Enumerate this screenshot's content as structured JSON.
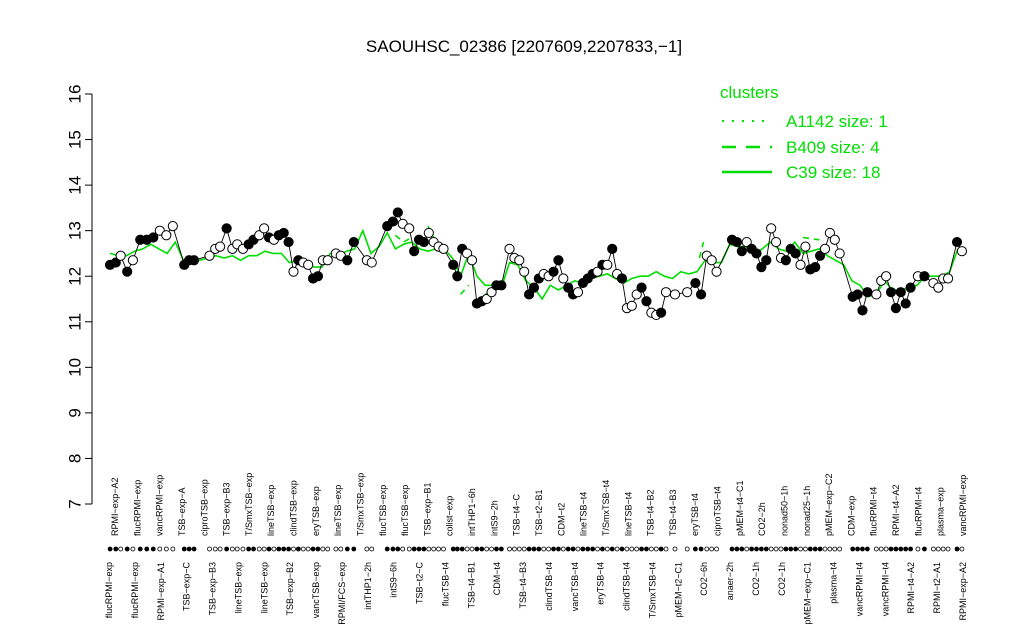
{
  "chart_data": {
    "type": "line",
    "title": "SAOUHSC_02386 [2207609,2207833,−1]",
    "xlabel": "",
    "ylabel": "",
    "ylim": [
      7,
      16
    ],
    "yticks": [
      7,
      8,
      9,
      10,
      11,
      12,
      13,
      14,
      15,
      16
    ],
    "grid": false,
    "legend": {
      "position": "top-right",
      "title": "clusters",
      "entries": [
        {
          "label": "A1142 size: 1",
          "style": "dotted"
        },
        {
          "label": "B409 size: 4",
          "style": "dashed"
        },
        {
          "label": "C39 size: 18",
          "style": "solid"
        }
      ]
    },
    "colors": {
      "line": "#00dd00",
      "points": "#000000",
      "text": "#000000"
    },
    "top_labels": [
      "RPMI−exp−A2",
      "flucRPMI−exp",
      "vancRPMI−exp",
      "TSB−exp−A",
      "ciproTSB−exp",
      "TSB−exp−B3",
      "T/SmxTSB−exp",
      "lineTSB−exp",
      "clindTSB−exp",
      "eryTSB−exp",
      "lineTSB−exp",
      "T/SmxTSB−exp",
      "flucTSB−exp",
      "flucTSB−exp",
      "TSB−exp−B1",
      "colist−exp",
      "intTHP1−6h",
      "intS9−2h",
      "TSB−t4−C",
      "TSB−t2−B1",
      "CDM−t2",
      "lineTSB−t4",
      "T/SmxTSB−t4",
      "lineTSB−t4",
      "TSB−t4−B2",
      "TSB−t4−B3",
      "eryTSB−t4",
      "ciproTSB−t4",
      "pMEM−t4−C1",
      "CO2−2h",
      "nonad50−1h",
      "nonad25−1h",
      "pMEM−exp−C2",
      "CDM−exp",
      "flucRPMI−t4",
      "RPMI−t4−A2",
      "flucRPMI−t4",
      "plasma−exp",
      "vancRPMI−exp"
    ],
    "bottom_labels": [
      "flucRPMI−exp",
      "flucRPMI−exp",
      "RPMI−exp−A1",
      "TSB−exp−C",
      "TSB−exp−B3",
      "lineTSB−exp",
      "lineTSB−exp",
      "TSB−exp−B2",
      "vancTSB−exp",
      "RPMI/FCS−exp",
      "intTHP1−2h",
      "intS9−6h",
      "TSB−t2−C",
      "flucTSB−t4",
      "TSB−t4−B1",
      "CDM−t4",
      "TSB−t4−B3",
      "clindTSB−t4",
      "vancTSB−t4",
      "eryTSB−t4",
      "clindTSB−t4",
      "T/SmxTSB−t4",
      "pMEM−t2−C1",
      "CO2−6h",
      "anaer−2h",
      "CO2−1h",
      "CO2−1h",
      "pMEM−exp−C1",
      "plasma−t4",
      "vancRPMI−t4",
      "vancRPMI−t4",
      "RPMI−t4−A2",
      "RPMI−t2−A1",
      "RPMI−exp−A2"
    ],
    "points": [
      [
        0.5,
        12.25,
        1
      ],
      [
        1.2,
        12.3,
        1
      ],
      [
        1.8,
        12.45,
        0
      ],
      [
        2.6,
        12.1,
        1
      ],
      [
        3.3,
        12.35,
        0
      ],
      [
        4.2,
        12.8,
        1
      ],
      [
        5,
        12.8,
        1
      ],
      [
        5.8,
        12.85,
        1
      ],
      [
        6.6,
        13,
        0
      ],
      [
        7.4,
        12.9,
        0
      ],
      [
        8.2,
        13.1,
        0
      ],
      [
        9.6,
        12.25,
        1
      ],
      [
        10.2,
        12.35,
        1
      ],
      [
        10.8,
        12.35,
        1
      ],
      [
        12.7,
        12.45,
        0
      ],
      [
        13.4,
        12.6,
        0
      ],
      [
        14,
        12.65,
        0
      ],
      [
        14.8,
        13.05,
        1
      ],
      [
        15.5,
        12.6,
        0
      ],
      [
        16.1,
        12.7,
        0
      ],
      [
        16.8,
        12.6,
        0
      ],
      [
        17.5,
        12.7,
        1
      ],
      [
        18.1,
        12.8,
        1
      ],
      [
        18.8,
        12.9,
        0
      ],
      [
        19.4,
        13.05,
        0
      ],
      [
        20,
        12.85,
        1
      ],
      [
        20.6,
        12.8,
        0
      ],
      [
        21.2,
        12.9,
        1
      ],
      [
        21.8,
        12.95,
        1
      ],
      [
        22.4,
        12.75,
        1
      ],
      [
        23,
        12.1,
        0
      ],
      [
        23.6,
        12.35,
        1
      ],
      [
        24.2,
        12.3,
        0
      ],
      [
        24.8,
        12.25,
        0
      ],
      [
        25.4,
        11.95,
        1
      ],
      [
        26,
        12.0,
        1
      ],
      [
        26.6,
        12.35,
        0
      ],
      [
        27.2,
        12.35,
        0
      ],
      [
        28.2,
        12.5,
        0
      ],
      [
        28.8,
        12.45,
        0
      ],
      [
        29.6,
        12.35,
        1
      ],
      [
        30.4,
        12.75,
        1
      ],
      [
        32,
        12.35,
        0
      ],
      [
        32.6,
        12.3,
        0
      ],
      [
        34.5,
        13.1,
        1
      ],
      [
        35.2,
        13.2,
        1
      ],
      [
        35.8,
        13.4,
        1
      ],
      [
        36.4,
        13.15,
        0
      ],
      [
        37.2,
        13.05,
        0
      ],
      [
        37.8,
        12.55,
        1
      ],
      [
        38.4,
        12.8,
        1
      ],
      [
        39,
        12.75,
        1
      ],
      [
        39.6,
        12.95,
        0
      ],
      [
        40.2,
        12.75,
        0
      ],
      [
        40.8,
        12.65,
        0
      ],
      [
        41.4,
        12.6,
        0
      ],
      [
        42.6,
        12.25,
        1
      ],
      [
        43.1,
        12.0,
        1
      ],
      [
        43.7,
        12.6,
        1
      ],
      [
        44.3,
        12.5,
        0
      ],
      [
        44.9,
        12.35,
        0
      ],
      [
        45.5,
        11.4,
        1
      ],
      [
        46.1,
        11.45,
        1
      ],
      [
        46.7,
        11.5,
        0
      ],
      [
        47.3,
        11.65,
        0
      ],
      [
        47.9,
        11.8,
        1
      ],
      [
        48.5,
        11.8,
        1
      ],
      [
        49.5,
        12.6,
        0
      ],
      [
        50.1,
        12.4,
        0
      ],
      [
        50.7,
        12.35,
        0
      ],
      [
        51.3,
        12.1,
        0
      ],
      [
        51.9,
        11.6,
        1
      ],
      [
        52.5,
        11.75,
        1
      ],
      [
        53.1,
        11.95,
        1
      ],
      [
        53.7,
        12.05,
        0
      ],
      [
        54.3,
        12.0,
        0
      ],
      [
        54.9,
        12.1,
        1
      ],
      [
        55.5,
        12.35,
        1
      ],
      [
        56.1,
        11.95,
        0
      ],
      [
        56.7,
        11.75,
        1
      ],
      [
        57.3,
        11.6,
        1
      ],
      [
        57.9,
        11.65,
        0
      ],
      [
        58.5,
        11.85,
        1
      ],
      [
        59.1,
        11.95,
        1
      ],
      [
        59.7,
        12.05,
        1
      ],
      [
        60.3,
        12.1,
        0
      ],
      [
        60.9,
        12.25,
        1
      ],
      [
        61.5,
        12.25,
        0
      ],
      [
        62.1,
        12.6,
        1
      ],
      [
        62.7,
        12.05,
        0
      ],
      [
        63.3,
        11.95,
        1
      ],
      [
        63.9,
        11.3,
        0
      ],
      [
        64.5,
        11.35,
        0
      ],
      [
        65.1,
        11.6,
        0
      ],
      [
        65.7,
        11.75,
        1
      ],
      [
        66.3,
        11.45,
        1
      ],
      [
        66.9,
        11.2,
        0
      ],
      [
        67.5,
        11.15,
        0
      ],
      [
        68.1,
        11.2,
        1
      ],
      [
        68.7,
        11.65,
        0
      ],
      [
        69.8,
        11.6,
        0
      ],
      [
        71.3,
        11.65,
        0
      ],
      [
        72.3,
        11.85,
        1
      ],
      [
        73,
        11.6,
        1
      ],
      [
        73.7,
        12.45,
        0
      ],
      [
        74.3,
        12.35,
        0
      ],
      [
        74.9,
        12.1,
        0
      ],
      [
        76.8,
        12.8,
        1
      ],
      [
        77.4,
        12.75,
        1
      ],
      [
        78,
        12.55,
        1
      ],
      [
        78.6,
        12.75,
        0
      ],
      [
        79.2,
        12.6,
        1
      ],
      [
        79.8,
        12.5,
        1
      ],
      [
        80.4,
        12.2,
        1
      ],
      [
        81,
        12.35,
        1
      ],
      [
        81.6,
        13.05,
        0
      ],
      [
        82.2,
        12.75,
        0
      ],
      [
        82.8,
        12.4,
        0
      ],
      [
        83.4,
        12.35,
        1
      ],
      [
        84,
        12.6,
        1
      ],
      [
        84.6,
        12.5,
        1
      ],
      [
        85.2,
        12.25,
        0
      ],
      [
        85.8,
        12.65,
        0
      ],
      [
        86.4,
        12.15,
        1
      ],
      [
        87,
        12.2,
        1
      ],
      [
        87.6,
        12.45,
        1
      ],
      [
        88.2,
        12.6,
        0
      ],
      [
        88.8,
        12.95,
        0
      ],
      [
        89.4,
        12.8,
        0
      ],
      [
        90,
        12.5,
        0
      ],
      [
        91.6,
        11.55,
        1
      ],
      [
        92.2,
        11.6,
        1
      ],
      [
        92.8,
        11.25,
        1
      ],
      [
        93.4,
        11.65,
        1
      ],
      [
        94.5,
        11.6,
        0
      ],
      [
        95.1,
        11.9,
        0
      ],
      [
        95.7,
        12.0,
        0
      ],
      [
        96.3,
        11.65,
        1
      ],
      [
        96.9,
        11.3,
        1
      ],
      [
        97.5,
        11.65,
        1
      ],
      [
        98.1,
        11.4,
        1
      ],
      [
        98.7,
        11.75,
        1
      ],
      [
        99.6,
        12.0,
        0
      ],
      [
        100.4,
        12.0,
        1
      ],
      [
        101.5,
        11.85,
        0
      ],
      [
        102.1,
        11.75,
        0
      ],
      [
        102.7,
        11.95,
        0
      ],
      [
        103.3,
        11.95,
        0
      ],
      [
        104.4,
        12.75,
        1
      ],
      [
        105,
        12.55,
        0
      ]
    ],
    "series": [
      {
        "name": "C39 size: 18",
        "style": "solid",
        "points": [
          [
            0.5,
            12.5
          ],
          [
            1.5,
            12.45
          ],
          [
            2.5,
            12.45
          ],
          [
            3.5,
            12.55
          ],
          [
            4.5,
            12.6
          ],
          [
            5.5,
            12.7
          ],
          [
            6.5,
            12.6
          ],
          [
            7.5,
            12.5
          ],
          [
            8.5,
            12.75
          ],
          [
            9.5,
            12.35
          ],
          [
            10.5,
            12.4
          ],
          [
            11.5,
            12.35
          ],
          [
            12.5,
            12.4
          ],
          [
            13.5,
            12.45
          ],
          [
            14.5,
            12.4
          ],
          [
            15.5,
            12.45
          ],
          [
            16.5,
            12.35
          ],
          [
            17.5,
            12.45
          ],
          [
            18.5,
            12.45
          ],
          [
            19.5,
            12.55
          ],
          [
            20.5,
            12.5
          ],
          [
            21.5,
            12.5
          ],
          [
            22.5,
            12.3
          ],
          [
            23.5,
            12.35
          ],
          [
            24.5,
            12.35
          ],
          [
            25.5,
            12.2
          ],
          [
            26.5,
            12.2
          ],
          [
            27.5,
            12.5
          ],
          [
            28.5,
            12.45
          ],
          [
            29.5,
            12.55
          ],
          [
            30.5,
            12.6
          ],
          [
            31.5,
            13.0
          ],
          [
            32.5,
            12.5
          ],
          [
            33.5,
            12.65
          ],
          [
            34.5,
            12.95
          ],
          [
            35.5,
            12.6
          ],
          [
            36.5,
            12.7
          ],
          [
            37.5,
            12.75
          ],
          [
            38.5,
            12.6
          ],
          [
            39.5,
            12.55
          ],
          [
            40.5,
            12.6
          ],
          [
            41.5,
            12.6
          ],
          [
            42.5,
            12.4
          ],
          [
            43.5,
            12.0
          ],
          [
            44.5,
            12.5
          ],
          [
            45.5,
            12.0
          ],
          [
            46.5,
            11.8
          ],
          [
            47.5,
            11.8
          ],
          [
            48.5,
            11.75
          ],
          [
            49.5,
            12.3
          ],
          [
            50.5,
            12.25
          ],
          [
            51.5,
            11.9
          ],
          [
            52.5,
            11.75
          ],
          [
            53.5,
            11.5
          ],
          [
            54.5,
            11.8
          ],
          [
            55.5,
            11.7
          ],
          [
            56.5,
            11.8
          ],
          [
            57.5,
            11.9
          ],
          [
            58.5,
            11.85
          ],
          [
            59.5,
            11.95
          ],
          [
            60.5,
            12.0
          ],
          [
            61.5,
            12.05
          ],
          [
            62.5,
            11.95
          ],
          [
            63.5,
            11.85
          ],
          [
            64.5,
            11.95
          ],
          [
            65.5,
            12.0
          ],
          [
            66.5,
            12.0
          ],
          [
            67.5,
            12.1
          ],
          [
            68.5,
            12.0
          ],
          [
            69.5,
            11.95
          ],
          [
            70.5,
            12.1
          ],
          [
            71.5,
            12.05
          ],
          [
            72.5,
            12.1
          ],
          [
            73.5,
            12.35
          ],
          [
            74.5,
            12.3
          ],
          [
            75.5,
            12.3
          ],
          [
            76.5,
            12.7
          ],
          [
            77.5,
            12.65
          ],
          [
            78.5,
            12.65
          ],
          [
            79.5,
            12.45
          ],
          [
            80.5,
            12.6
          ],
          [
            81.5,
            12.75
          ],
          [
            82.5,
            12.6
          ],
          [
            83.5,
            12.55
          ],
          [
            84.5,
            12.75
          ],
          [
            85.5,
            12.5
          ],
          [
            86.5,
            12.55
          ],
          [
            87.5,
            12.6
          ],
          [
            88.5,
            12.45
          ],
          [
            89.5,
            12.35
          ],
          [
            90.5,
            12.25
          ],
          [
            91.5,
            11.9
          ],
          [
            92.5,
            11.8
          ],
          [
            93.5,
            11.55
          ],
          [
            94.5,
            11.6
          ],
          [
            95.5,
            11.9
          ],
          [
            96.5,
            11.7
          ],
          [
            97.5,
            11.7
          ],
          [
            98.5,
            11.75
          ],
          [
            99.5,
            11.8
          ],
          [
            100.5,
            12.0
          ],
          [
            101.5,
            12.0
          ],
          [
            102.5,
            12.0
          ],
          [
            103.5,
            12.1
          ],
          [
            104.5,
            12.6
          ]
        ]
      },
      {
        "name": "B409 size: 4",
        "style": "dashed",
        "segments": [
          [
            [
              35.5,
              12.9
            ],
            [
              36.5,
              12.75
            ],
            [
              37.5,
              12.85
            ]
          ],
          [
            [
              39.5,
              13.1
            ],
            [
              40.5,
              12.75
            ]
          ],
          [
            [
              43.5,
              11.6
            ],
            [
              44.5,
              11.8
            ]
          ],
          [
            [
              46.5,
              11.6
            ],
            [
              47.5,
              11.7
            ]
          ],
          [
            [
              72.8,
              12.4
            ],
            [
              73.3,
              12.75
            ]
          ],
          [
            [
              82.5,
              12.5
            ],
            [
              83.5,
              12.35
            ]
          ],
          [
            [
              85.5,
              12.85
            ],
            [
              87.5,
              12.8
            ]
          ]
        ]
      }
    ]
  }
}
